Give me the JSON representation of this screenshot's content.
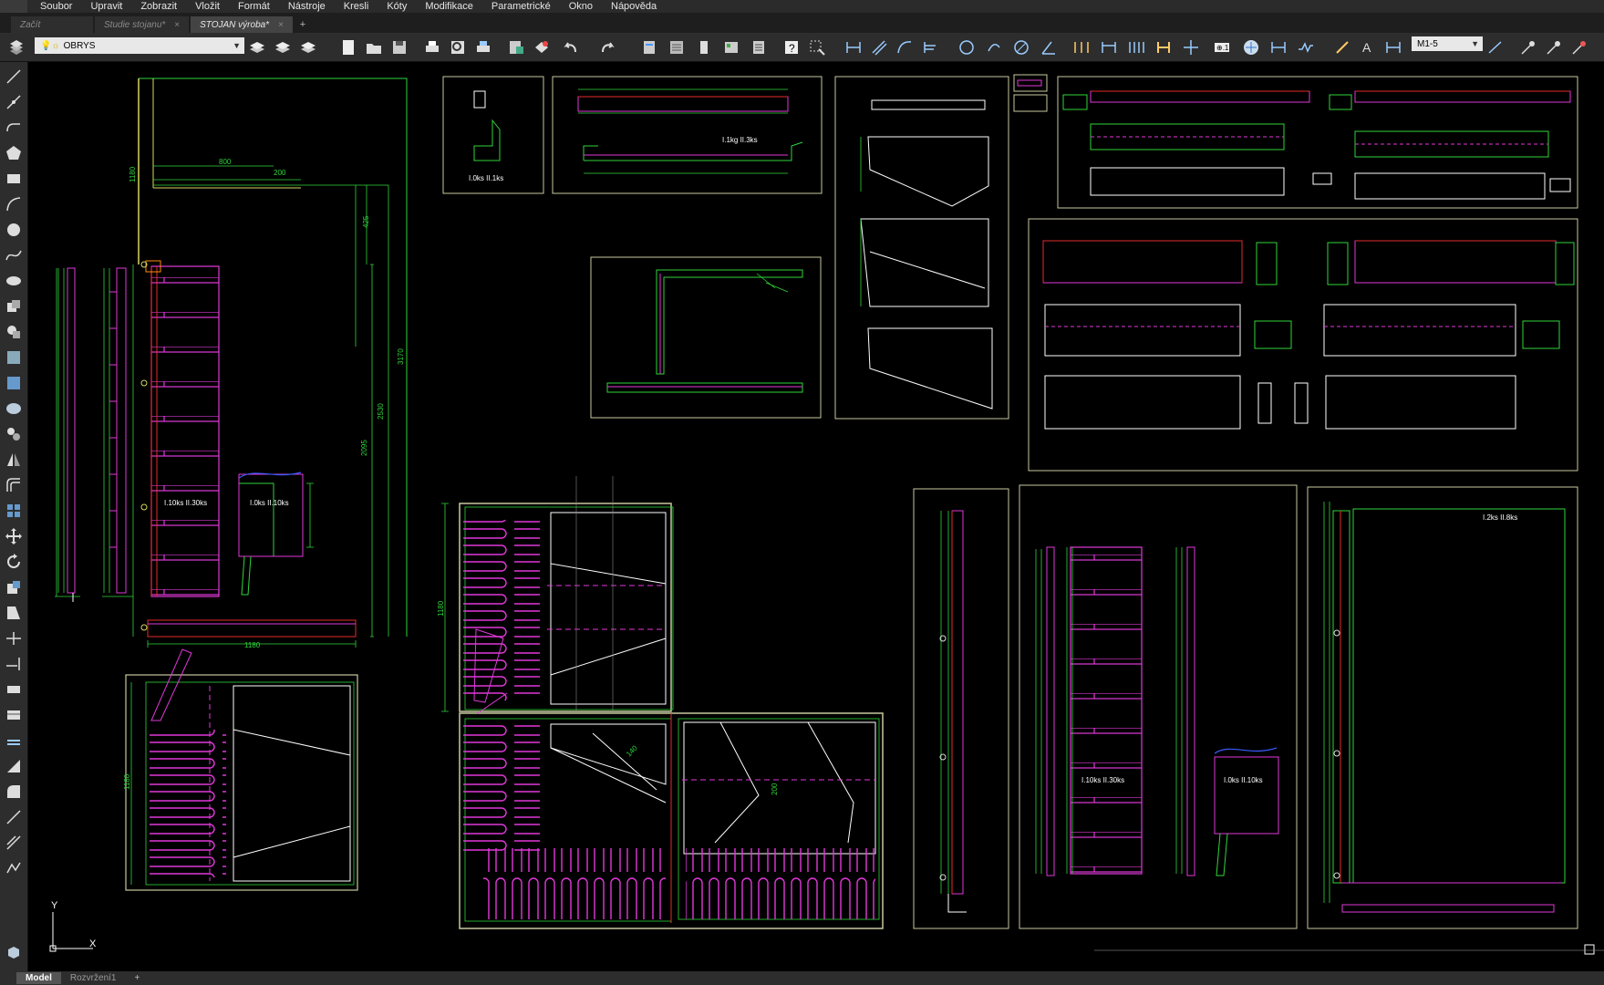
{
  "menu": [
    "Soubor",
    "Upravit",
    "Zobrazit",
    "Vložit",
    "Formát",
    "Nástroje",
    "Kresli",
    "Kóty",
    "Modifikace",
    "Parametrické",
    "Okno",
    "Nápověda"
  ],
  "tabs": [
    {
      "label": "Začít",
      "active": false
    },
    {
      "label": "Studie stojanu*",
      "active": false
    },
    {
      "label": "STOJAN výroba*",
      "active": true
    }
  ],
  "toolbar": {
    "layer_name": "OBRYS",
    "dim_style": "M1-5"
  },
  "layout_tabs": [
    {
      "label": "Model",
      "active": true
    },
    {
      "label": "Rozvržení1",
      "active": false
    }
  ],
  "drawing": {
    "dims": {
      "d800": "800",
      "d200": "200",
      "d1180a": "1180",
      "d425": "425",
      "d2530": "2530",
      "d2095": "2095",
      "d3170": "3170",
      "d1180b": "1180",
      "d1180c": "1180",
      "d1180d": "1180",
      "d200b": "200",
      "d140": "140"
    },
    "notes": {
      "n1": "I.0ks II.1ks",
      "n2": "I.1kg II.3ks",
      "n3": "I.10ks II.30ks",
      "n4": "I.0ks II.10ks",
      "n5": "I.10ks II.30ks",
      "n6": "I.0ks II.10ks",
      "n7": "I.2ks II.8ks"
    },
    "ucs": {
      "x": "X",
      "y": "Y"
    }
  },
  "colors": {
    "accent_tab": "#444444",
    "lines_green": "#2fd53a",
    "lines_magenta": "#e038d8",
    "lines_red": "#e52b2b",
    "lines_yellow": "#d8d860",
    "frame": "#c8c8a0"
  }
}
